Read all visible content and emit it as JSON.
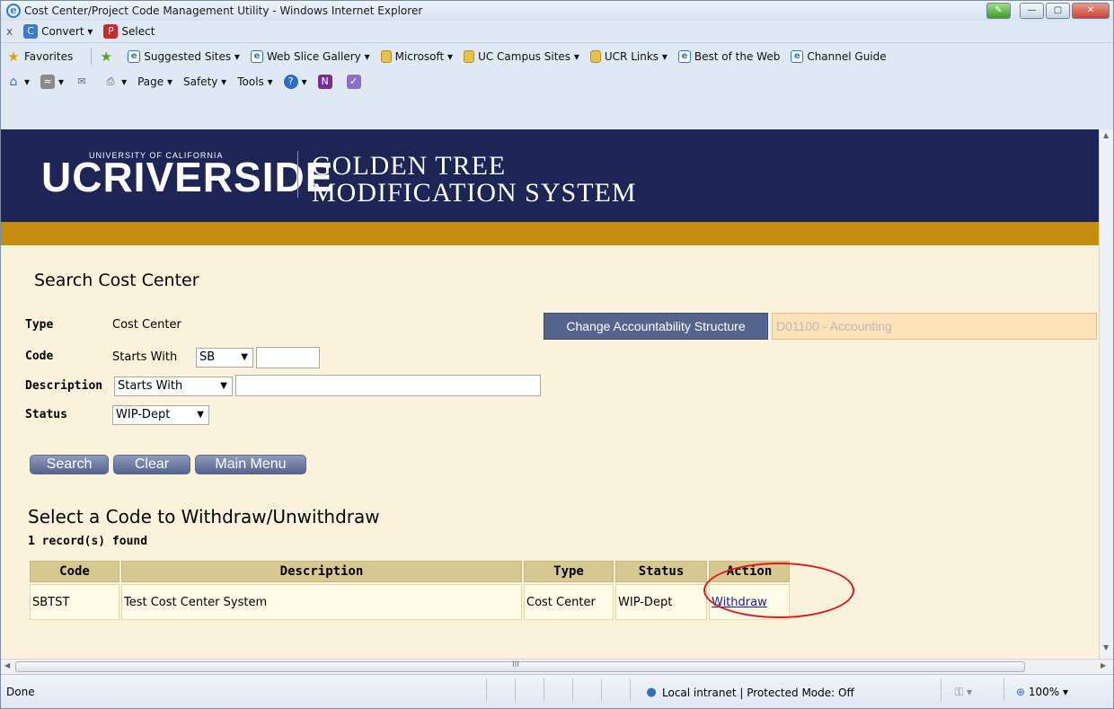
{
  "window": {
    "title": "Cost Center/Project Code Management Utility - Windows Internet Explorer"
  },
  "toolbar1": {
    "close_x": "x",
    "convert": "Convert",
    "select": "Select"
  },
  "favorites_bar": {
    "favorites": "Favorites",
    "items": [
      "Suggested Sites ▾",
      "Web Slice Gallery ▾",
      "Microsoft ▾",
      "UC Campus Sites ▾",
      "UCR Links ▾",
      "Best of the Web",
      "Channel Guide"
    ]
  },
  "command_bar": {
    "page": "Page ▾",
    "safety": "Safety ▾",
    "tools": "Tools ▾"
  },
  "banner": {
    "uc": "UCRIVERSIDE",
    "small": "UNIVERSITY OF CALIFORNIA",
    "title_line1": "GOLDEN TREE",
    "title_line2": "MODIFICATION SYSTEM"
  },
  "search": {
    "heading": "Search Cost Center",
    "type_label": "Type",
    "type_value": "Cost Center",
    "code_label": "Code",
    "code_match": "Starts With",
    "code_prefix": "SB",
    "code_value": "",
    "desc_label": "Description",
    "desc_match": "Starts With",
    "desc_value": "",
    "status_label": "Status",
    "status_value": "WIP-Dept",
    "change_button": "Change Accountability Structure",
    "accountability_value": "D01100 - Accounting",
    "buttons": {
      "search": "Search",
      "clear": "Clear",
      "main_menu": "Main Menu"
    }
  },
  "results": {
    "heading": "Select a Code to Withdraw/Unwithdraw",
    "count": "1 record(s) found",
    "columns": [
      "Code",
      "Description",
      "Type",
      "Status",
      "Action"
    ],
    "rows": [
      {
        "code": "SBTST",
        "description": "Test Cost Center System",
        "type": "Cost Center",
        "status": "WIP-Dept",
        "action": "Withdraw"
      }
    ]
  },
  "scrollbar": {
    "thumb_grip": "III"
  },
  "statusbar": {
    "left": "Done",
    "zone": "Local intranet | Protected Mode: Off",
    "zoom": "100%"
  }
}
